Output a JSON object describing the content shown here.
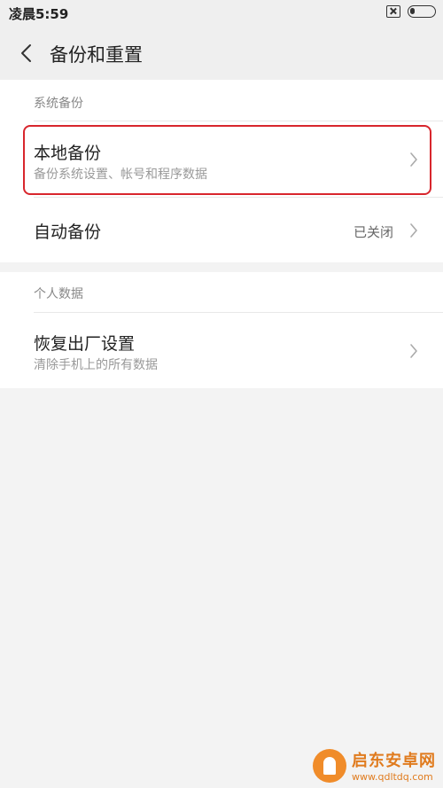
{
  "status_bar": {
    "time": "凌晨5:59"
  },
  "header": {
    "title": "备份和重置"
  },
  "sections": [
    {
      "header": "系统备份",
      "items": [
        {
          "title": "本地备份",
          "subtitle": "备份系统设置、帐号和程序数据",
          "value": ""
        },
        {
          "title": "自动备份",
          "subtitle": "",
          "value": "已关闭"
        }
      ]
    },
    {
      "header": "个人数据",
      "items": [
        {
          "title": "恢复出厂设置",
          "subtitle": "清除手机上的所有数据",
          "value": ""
        }
      ]
    }
  ],
  "watermark": {
    "name": "启东安卓网",
    "url": "www.qdltdq.com"
  },
  "colors": {
    "highlight": "#d8262d",
    "accent": "#e07b1e"
  },
  "icons": [
    "back-arrow-icon",
    "chevron-right-icon",
    "sim-card-icon",
    "battery-icon"
  ]
}
